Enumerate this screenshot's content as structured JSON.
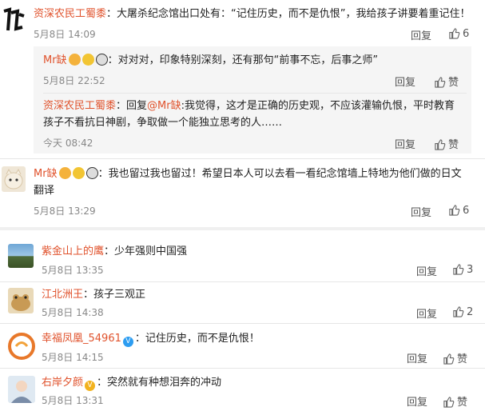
{
  "actions": {
    "reply": "回复",
    "like": "赞"
  },
  "comments": [
    {
      "user": "资深农民工蜀黍",
      "text": "大屠杀纪念馆出口处有：“记住历史，而不是仇恨”，我给孩子讲要着重记住！",
      "time": "5月8日 14:09",
      "likes": "6",
      "replies": [
        {
          "user": "Mr缺",
          "text": "对对对，印象特别深刻，还有那句“前事不忘，后事之师”",
          "time": "5月8日 22:52"
        },
        {
          "user": "资深农民工蜀黍",
          "text_prefix": "回复",
          "mention": "@Mr缺",
          "text": ":我觉得，这才是正确的历史观，不应该灌输仇恨，平时教育",
          "text2": "孩子不看抗日神剧，争取做一个能独立思考的人……",
          "time": "今天 08:42"
        }
      ]
    },
    {
      "user": "Mr缺",
      "text": "我也留过我也留过！希望日本人可以去看一看纪念馆墙上特地为他们做的日文",
      "text2": "翻译",
      "time": "5月8日 13:29",
      "likes": "6"
    },
    {
      "user": "紫金山上的鹰",
      "text": "少年强则中国强",
      "time": "5月8日 13:35",
      "likes": "3"
    },
    {
      "user": "江北洲王",
      "text": "孩子三观正",
      "time": "5月8日 14:38",
      "likes": "2"
    },
    {
      "user": "幸福凤凰_54961",
      "text": "记住历史，而不是仇恨！",
      "time": "5月8日 14:15"
    },
    {
      "user": "右岸夕颜",
      "text": "突然就有种想泪奔的冲动",
      "time": "5月8日 13:31"
    }
  ]
}
